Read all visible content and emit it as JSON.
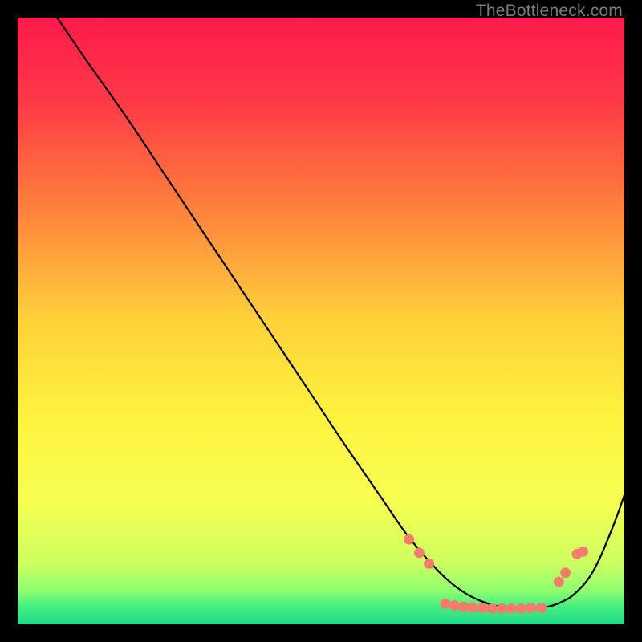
{
  "watermark": "TheBottleneck.com",
  "chart_data": {
    "type": "line",
    "title": "",
    "xlabel": "",
    "ylabel": "",
    "xlim": [
      0,
      100
    ],
    "ylim": [
      0,
      100
    ],
    "grid": false,
    "legend": false,
    "background_gradient": {
      "stops": [
        {
          "offset": 0.0,
          "color": "#ff1a4b"
        },
        {
          "offset": 0.14,
          "color": "#ff3a47"
        },
        {
          "offset": 0.3,
          "color": "#ff7a3c"
        },
        {
          "offset": 0.5,
          "color": "#ffd23a"
        },
        {
          "offset": 0.66,
          "color": "#fff33e"
        },
        {
          "offset": 0.8,
          "color": "#f6ff52"
        },
        {
          "offset": 0.9,
          "color": "#ccff60"
        },
        {
          "offset": 0.945,
          "color": "#8dff70"
        },
        {
          "offset": 0.97,
          "color": "#46f07e"
        },
        {
          "offset": 1.0,
          "color": "#1fd98a"
        }
      ]
    },
    "series": [
      {
        "name": "bottleneck-curve",
        "color": "#000000",
        "stroke_width": 2.2,
        "x": [
          6.5,
          12,
          18,
          24,
          30,
          36,
          42,
          48,
          54,
          60,
          64,
          68,
          71,
          74,
          77,
          80,
          83,
          86,
          89,
          92,
          95,
          98,
          100
        ],
        "y": [
          100,
          92,
          83.5,
          74.5,
          65.5,
          56.5,
          47.5,
          38.5,
          29.5,
          20.8,
          15,
          10.2,
          7.2,
          5.0,
          3.6,
          2.8,
          2.6,
          2.7,
          3.4,
          5.2,
          9.0,
          15.8,
          21.3
        ]
      }
    ],
    "markers": {
      "name": "highlight-dots",
      "color": "#f47c6d",
      "radius": 6.5,
      "points": [
        {
          "x": 64.5,
          "y": 14.0
        },
        {
          "x": 66.2,
          "y": 11.8
        },
        {
          "x": 67.8,
          "y": 10.0
        },
        {
          "x": 70.5,
          "y": 3.4
        },
        {
          "x": 72.0,
          "y": 3.1
        },
        {
          "x": 73.5,
          "y": 2.9
        },
        {
          "x": 75.0,
          "y": 2.8
        },
        {
          "x": 76.6,
          "y": 2.7
        },
        {
          "x": 78.2,
          "y": 2.6
        },
        {
          "x": 79.8,
          "y": 2.6
        },
        {
          "x": 81.4,
          "y": 2.6
        },
        {
          "x": 83.0,
          "y": 2.6
        },
        {
          "x": 84.6,
          "y": 2.7
        },
        {
          "x": 86.3,
          "y": 2.7
        },
        {
          "x": 89.2,
          "y": 7.0
        },
        {
          "x": 90.3,
          "y": 8.5
        },
        {
          "x": 92.2,
          "y": 11.6
        },
        {
          "x": 93.2,
          "y": 12.0
        }
      ]
    }
  }
}
